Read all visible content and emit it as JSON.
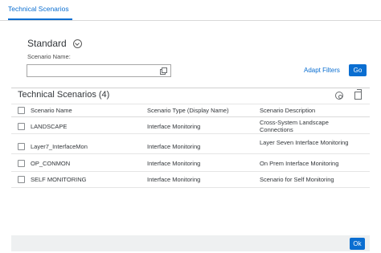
{
  "tabs": [
    {
      "label": "Technical Scenarios"
    }
  ],
  "filter_bar": {
    "variant_title": "Standard",
    "field_label": "Scenario Name:",
    "field_value": "",
    "adapt_filters_label": "Adapt Filters",
    "go_label": "Go"
  },
  "table": {
    "title": "Technical Scenarios (4)",
    "columns": [
      "Scenario Name",
      "Scenario Type (Display Name)",
      "Scenario Description"
    ],
    "rows": [
      {
        "name": "LANDSCAPE",
        "type": "Interface Monitoring",
        "description": "Cross-System Landscape Connections"
      },
      {
        "name": "Layer7_InterfaceMon",
        "type": "Interface Monitoring",
        "description": "Layer Seven Interface Monitoring"
      },
      {
        "name": "OP_CONMON",
        "type": "Interface Monitoring",
        "description": "On Prem Interface Monitoring"
      },
      {
        "name": "SELF MONITORING",
        "type": "Interface Monitoring",
        "description": "Scenario for Self Monitoring"
      }
    ]
  },
  "footer": {
    "ok_label": "Ok"
  },
  "icons": {
    "collapse": "chevron-up-circle-icon",
    "value_help": "value-help-icon",
    "settings": "settings-icon",
    "export": "export-icon"
  },
  "colors": {
    "accent": "#0a6ed1",
    "footer_bg": "#eef0f1"
  }
}
